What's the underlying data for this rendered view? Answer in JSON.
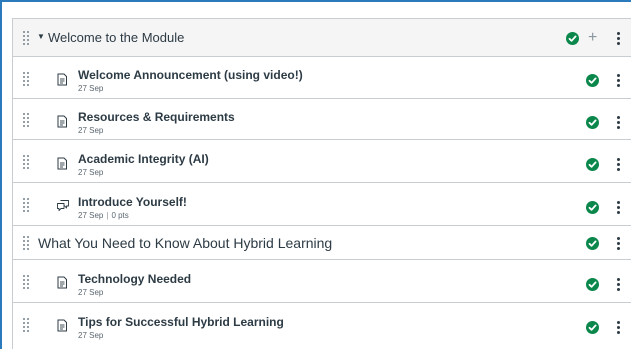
{
  "module": {
    "title": "Welcome to the Module",
    "add_symbol": "+"
  },
  "items": [
    {
      "title": "Welcome Announcement (using video!)",
      "date": "27 Sep",
      "type_icon": "page-icon"
    },
    {
      "title": "Resources & Requirements",
      "date": "27 Sep",
      "type_icon": "page-icon"
    },
    {
      "title": "Academic Integrity (AI)",
      "date": "27 Sep",
      "type_icon": "page-icon"
    },
    {
      "title": "Introduce Yourself!",
      "date": "27 Sep",
      "points": "0 pts",
      "separator": "|",
      "type_icon": "discussion-icon"
    }
  ],
  "sub_header": {
    "title": "What You Need to Know About Hybrid Learning"
  },
  "items2": [
    {
      "title": "Technology Needed",
      "date": "27 Sep",
      "type_icon": "page-icon"
    },
    {
      "title": "Tips for Successful Hybrid Learning",
      "date": "27 Sep",
      "type_icon": "page-icon"
    }
  ],
  "colors": {
    "accent_border": "#2b7abc",
    "published_green": "#0b874b",
    "header_bg": "#f5f5f5",
    "divider": "#c7cdd1"
  }
}
